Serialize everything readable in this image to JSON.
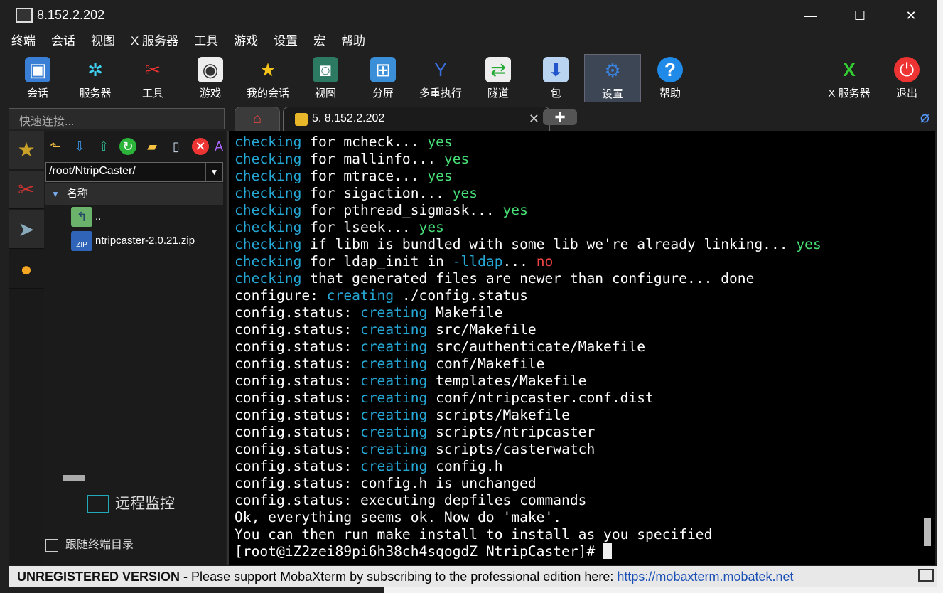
{
  "window": {
    "title": "8.152.2.202",
    "minimize": "—",
    "maximize": "☐",
    "close": "✕"
  },
  "menu": [
    "终端",
    "会话",
    "视图",
    "X 服务器",
    "工具",
    "游戏",
    "设置",
    "宏",
    "帮助"
  ],
  "toolbar": {
    "session": "会话",
    "servers": "服务器",
    "tools": "工具",
    "games": "游戏",
    "my_sessions": "我的会话",
    "view": "视图",
    "split": "分屏",
    "multi_exec": "多重执行",
    "tunnel": "隧道",
    "packages": "包",
    "settings": "设置",
    "help": "帮助",
    "xserver": "X 服务器",
    "exit": "退出"
  },
  "quick_connect": {
    "placeholder": "快速连接..."
  },
  "tabs": {
    "session_tab": "5. 8.152.2.202",
    "close": "✕",
    "new": "✚"
  },
  "sidebar": {
    "path": "/root/NtripCaster/",
    "column_name": "名称",
    "files": [
      {
        "name": ".."
      },
      {
        "name": "ntripcaster-2.0.21.zip"
      }
    ],
    "remote_monitor": "远程监控",
    "follow_terminal": "跟随终端目录"
  },
  "terminal": {
    "lines": [
      [
        [
          "checking",
          "c"
        ],
        [
          " for mcheck... ",
          ""
        ],
        [
          "yes",
          "g"
        ]
      ],
      [
        [
          "checking",
          "c"
        ],
        [
          " for mallinfo... ",
          ""
        ],
        [
          "yes",
          "g"
        ]
      ],
      [
        [
          "checking",
          "c"
        ],
        [
          " for mtrace... ",
          ""
        ],
        [
          "yes",
          "g"
        ]
      ],
      [
        [
          "checking",
          "c"
        ],
        [
          " for sigaction... ",
          ""
        ],
        [
          "yes",
          "g"
        ]
      ],
      [
        [
          "checking",
          "c"
        ],
        [
          " for pthread_sigmask... ",
          ""
        ],
        [
          "yes",
          "g"
        ]
      ],
      [
        [
          "checking",
          "c"
        ],
        [
          " for lseek... ",
          ""
        ],
        [
          "yes",
          "g"
        ]
      ],
      [
        [
          "checking",
          "c"
        ],
        [
          " if libm is bundled with some lib we're already linking... ",
          ""
        ],
        [
          "yes",
          "g"
        ]
      ],
      [
        [
          "checking",
          "c"
        ],
        [
          " for ldap_init in ",
          ""
        ],
        [
          "-lldap",
          "c"
        ],
        [
          "... ",
          ""
        ],
        [
          "no",
          "r"
        ]
      ],
      [
        [
          "checking",
          "c"
        ],
        [
          " that generated files are newer than configure... done",
          ""
        ]
      ],
      [
        [
          "configure: ",
          ""
        ],
        [
          "creating",
          "c"
        ],
        [
          " ./config.status",
          ""
        ]
      ],
      [
        [
          "config.status: ",
          ""
        ],
        [
          "creating",
          "c"
        ],
        [
          " Makefile",
          ""
        ]
      ],
      [
        [
          "config.status: ",
          ""
        ],
        [
          "creating",
          "c"
        ],
        [
          " src/Makefile",
          ""
        ]
      ],
      [
        [
          "config.status: ",
          ""
        ],
        [
          "creating",
          "c"
        ],
        [
          " src/authenticate/Makefile",
          ""
        ]
      ],
      [
        [
          "config.status: ",
          ""
        ],
        [
          "creating",
          "c"
        ],
        [
          " conf/Makefile",
          ""
        ]
      ],
      [
        [
          "config.status: ",
          ""
        ],
        [
          "creating",
          "c"
        ],
        [
          " templates/Makefile",
          ""
        ]
      ],
      [
        [
          "config.status: ",
          ""
        ],
        [
          "creating",
          "c"
        ],
        [
          " conf/ntripcaster.conf.dist",
          ""
        ]
      ],
      [
        [
          "config.status: ",
          ""
        ],
        [
          "creating",
          "c"
        ],
        [
          " scripts/Makefile",
          ""
        ]
      ],
      [
        [
          "config.status: ",
          ""
        ],
        [
          "creating",
          "c"
        ],
        [
          " scripts/ntripcaster",
          ""
        ]
      ],
      [
        [
          "config.status: ",
          ""
        ],
        [
          "creating",
          "c"
        ],
        [
          " scripts/casterwatch",
          ""
        ]
      ],
      [
        [
          "config.status: ",
          ""
        ],
        [
          "creating",
          "c"
        ],
        [
          " config.h",
          ""
        ]
      ],
      [
        [
          "config.status: config.h is unchanged",
          ""
        ]
      ],
      [
        [
          "config.status: executing depfiles commands",
          ""
        ]
      ],
      [
        [
          "Ok, everything seems ok. Now do 'make'.",
          ""
        ]
      ],
      [
        [
          "You can then run make install to install as you specified",
          ""
        ]
      ],
      [
        [
          "[root@iZ2zei89pi6h38ch4sqogdZ NtripCaster]# ",
          ""
        ]
      ]
    ]
  },
  "status_bar": {
    "unregistered": "UNREGISTERED VERSION",
    "separator": " - ",
    "message": "Please support MobaXterm by subscribing to the professional edition here:",
    "link": "https://mobaxterm.mobatek.net"
  },
  "colors": {
    "cyan": "#26a8d6",
    "green": "#47e076",
    "red": "#f04444"
  }
}
